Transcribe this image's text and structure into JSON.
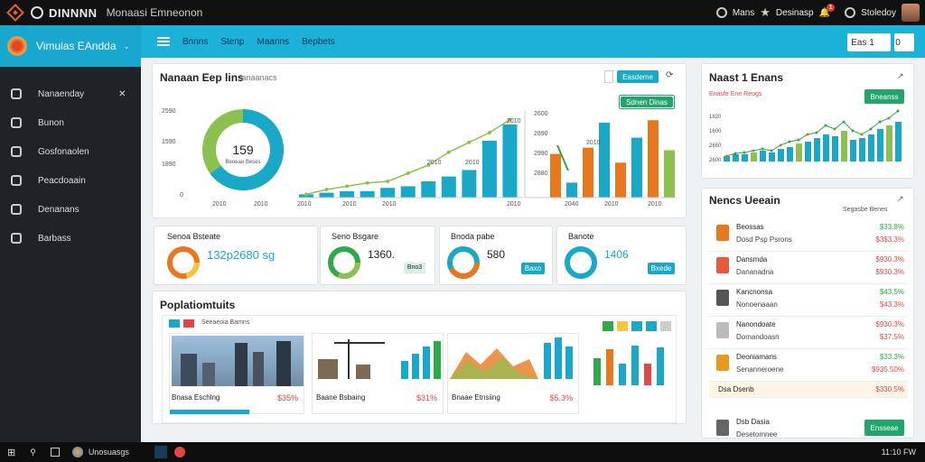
{
  "topbar": {
    "brand": "DINNNN",
    "subtitle": "Monaasi Emneonon",
    "item1": "Mans",
    "item2": "Desinasp",
    "item3": "Stoledoy",
    "notif_count": "1"
  },
  "sidebar": {
    "app_title": "Vimulas EAndda",
    "items": [
      {
        "label": "Nanaenday"
      },
      {
        "label": "Bunon"
      },
      {
        "label": "Gosfonaolen"
      },
      {
        "label": "Peacdoaain"
      },
      {
        "label": "Denanans"
      },
      {
        "label": "Barbass"
      }
    ]
  },
  "subbar": {
    "nav": [
      "Bnnns",
      "Stenp",
      "Maanns",
      "Bepbets"
    ],
    "btn1": "Eas 1",
    "btn2": "0"
  },
  "overview": {
    "title": "Nanaan Eep lins",
    "subtitle": "Ianaanacs",
    "btn": "Easdeme",
    "btn2": "Sdnen Dinas",
    "donut_value": "159",
    "donut_label": "Beoeae Beses",
    "y_left": [
      "2590",
      "1590",
      "1890",
      "0"
    ],
    "x_left": [
      "2010",
      "2010"
    ],
    "x_mid": [
      "2010",
      "2010",
      "2010",
      "2010"
    ],
    "y_right": [
      "2600",
      "2890",
      "2990",
      "2880",
      "2880"
    ],
    "x_right": [
      "2040",
      "2010",
      "2010"
    ],
    "labels_mid": [
      "2010",
      "2010",
      "2010",
      "2010"
    ],
    "labels_right": [
      "2010",
      "2010"
    ]
  },
  "kpis": [
    {
      "title": "Senoa Bsteate",
      "value": "132p2680 sg",
      "color": "#e8781e"
    },
    {
      "title": "Seno Bsgare",
      "value": "1360.",
      "btn": "Bno3",
      "color": "#2ea848"
    },
    {
      "title": "Bnoda pabe",
      "value": "580",
      "btn": "Baxo",
      "color": "#1aa8c9"
    },
    {
      "title": "Banote",
      "value": "1406",
      "btn": "Bxede",
      "color": "#1aa8c9"
    }
  ],
  "gallery": {
    "title": "Poplatiomtuits",
    "tags": [
      "Seeaeoia Bamns"
    ],
    "items": [
      {
        "name": "Bnasa Eschlng",
        "price": "$35%"
      },
      {
        "name": "Baane Bsbaing",
        "price": "$31%"
      },
      {
        "name": "Bnaae Etnsiing",
        "price": "$5,3%"
      }
    ]
  },
  "rightTop": {
    "title": "Naast 1 Enans",
    "subtitle": "Enasfe Ene Reogs",
    "btn": "Bneanss",
    "y": [
      "1820",
      "1600",
      "2650",
      "2600"
    ],
    "x": [
      "2510",
      "2510",
      "2510",
      "2610"
    ]
  },
  "rightList": {
    "title": "Nencs Ueeain",
    "header": "Segasbe Benes",
    "rows": [
      {
        "name": "Beossas",
        "sub": "Dosd Psp Psrons",
        "v1": "$33.8%",
        "v2": "$3$3.3%",
        "c": "#e8781e"
      },
      {
        "name": "Dansmda",
        "sub": "Dananadna",
        "v1": "$930.3%",
        "v2": "$930.3%",
        "c": "#e85b3a"
      },
      {
        "name": "Kancnonsa",
        "sub": "Nonoenaaan",
        "v1": "$43.5%",
        "v2": "$43.3%",
        "c": "#555"
      },
      {
        "name": "Nanondoate",
        "sub": "Domandoasn",
        "v1": "$930.3%",
        "v2": "$37.5%",
        "c": "#bbb"
      },
      {
        "name": "Deoniamans",
        "sub": "Senanneroene",
        "v1": "$33.3%",
        "v2": "$935.50%",
        "c": "#e89a1e"
      },
      {
        "name": "Dsa Dsenb",
        "sub": "",
        "v1": "$330.5%",
        "v2": "",
        "c": "#e8781e"
      },
      {
        "name": "Dsb Dasia",
        "sub": "Desetomnee",
        "v1": "",
        "v2": "",
        "c": "#666",
        "btn": "Ensseae"
      }
    ]
  },
  "taskbar": {
    "app": "Unosuasgs",
    "time": "11:10 FW"
  },
  "chart_data": [
    {
      "type": "pie",
      "values": [
        35,
        65
      ],
      "colors": [
        "#8cc152",
        "#1aa8c9"
      ]
    },
    {
      "type": "bar",
      "categories": [
        "1",
        "2",
        "3",
        "4",
        "5",
        "6",
        "7",
        "8",
        "9",
        "10",
        "11"
      ],
      "values": [
        2,
        3,
        4,
        4,
        6,
        7,
        10,
        13,
        17,
        35,
        45
      ],
      "line": [
        2,
        5,
        7,
        9,
        10,
        15,
        20,
        28,
        34,
        40,
        48
      ]
    },
    {
      "type": "bar",
      "values": [
        35,
        12,
        40,
        60,
        28,
        48,
        62,
        38
      ],
      "colors": [
        "#e8781e",
        "#1aa8c9",
        "#e8781e",
        "#1aa8c9",
        "#e8781e",
        "#1aa8c9",
        "#e8781e",
        "#8cc152"
      ]
    }
  ]
}
